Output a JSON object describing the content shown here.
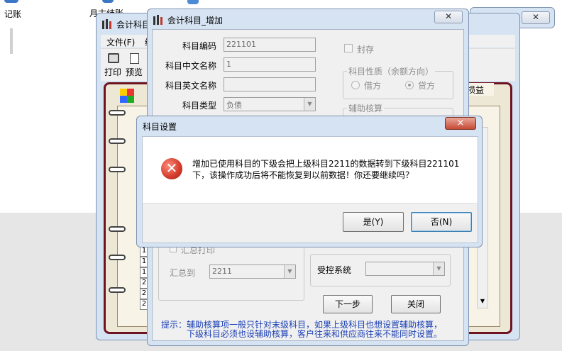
{
  "desktop": {
    "icon1_label": "记账",
    "icon2_label": "月末结账"
  },
  "back_window": {
    "title": "会计科目",
    "menu": [
      "文件(F)",
      "编"
    ],
    "toolbar": {
      "print": "打印",
      "preview": "预览"
    },
    "tab_right": "损益",
    "row_numbers": [
      "1",
      "1",
      "1",
      "2",
      "2",
      "2"
    ]
  },
  "add_dialog": {
    "title": "会计科目_增加",
    "code_label": "科目编码",
    "code_value": "221101",
    "cn_name_label": "科目中文名称",
    "cn_name_value": "1",
    "en_name_label": "科目英文名称",
    "en_name_value": "",
    "type_label": "科目类型",
    "type_value": "负债",
    "seal_label": "封存",
    "nature_group": "科目性质（余额方向）",
    "debit_label": "借方",
    "credit_label": "贷方",
    "aux_group": "辅助核算",
    "summary_print_label": "汇总打印",
    "summary_to_label": "汇总到",
    "summary_to_value": "2211",
    "controlled_label": "受控系统",
    "controlled_value": "",
    "next_button": "下一步",
    "close_button": "关闭",
    "hint_line1": "提示：辅助核算项一般只针对末级科目，如果上级科目也想设置辅助核算，",
    "hint_line2": "下级科目必须也设辅助核算，客户往来和供应商往来不能同时设置。"
  },
  "alert": {
    "title": "科目设置",
    "message_line1": "增加已使用科目的下级会把上级科目2211的数据转到下级科目221101",
    "message_line2": "下，该操作成功后将不能恢复到以前数据！你还要继续吗？",
    "yes_button": "是(Y)",
    "no_button": "否(N)",
    "close_glyph": "×"
  },
  "colors": {
    "hint_text": "#1a3fb5",
    "error_icon": "#d23a2a",
    "notebook_border": "#7a1520"
  }
}
